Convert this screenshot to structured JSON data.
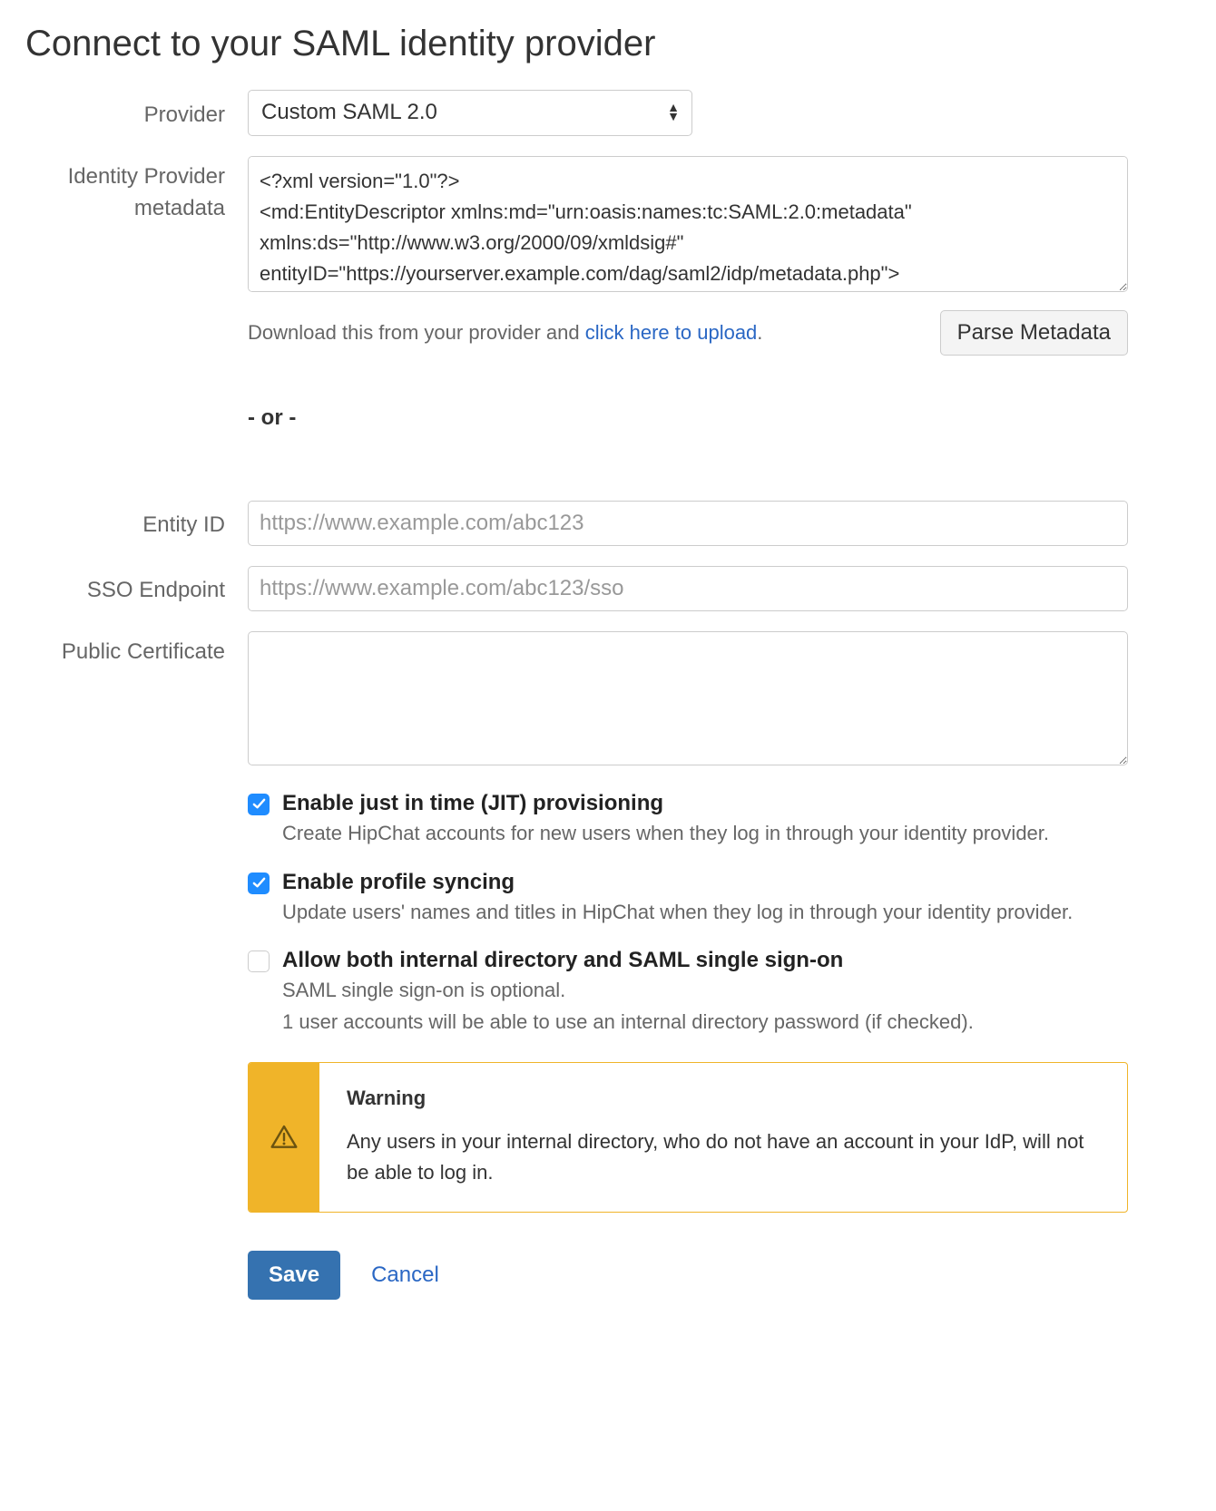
{
  "heading": "Connect to your SAML identity provider",
  "labels": {
    "provider": "Provider",
    "metadata": "Identity Provider metadata",
    "entity_id": "Entity ID",
    "sso_endpoint": "SSO Endpoint",
    "public_cert": "Public Certificate"
  },
  "provider": {
    "selected": "Custom SAML 2.0"
  },
  "metadata": {
    "value": "<?xml version=\"1.0\"?>\n<md:EntityDescriptor xmlns:md=\"urn:oasis:names:tc:SAML:2.0:metadata\" xmlns:ds=\"http://www.w3.org/2000/09/xmldsig#\" entityID=\"https://yourserver.example.com/dag/saml2/idp/metadata.php\">\n    <md:IDPSSODescriptor",
    "hint_prefix": "Download this from your provider and ",
    "hint_link": "click here to upload",
    "hint_suffix": ".",
    "parse_button": "Parse Metadata"
  },
  "or_separator": "- or -",
  "entity_id": {
    "placeholder": "https://www.example.com/abc123",
    "value": ""
  },
  "sso_endpoint": {
    "placeholder": "https://www.example.com/abc123/sso",
    "value": ""
  },
  "public_cert": {
    "value": ""
  },
  "checkboxes": {
    "jit": {
      "checked": true,
      "title": "Enable just in time (JIT) provisioning",
      "desc": "Create HipChat accounts for new users when they log in through your identity provider."
    },
    "sync": {
      "checked": true,
      "title": "Enable profile syncing",
      "desc": "Update users' names and titles in HipChat when they log in through your identity provider."
    },
    "allow_both": {
      "checked": false,
      "title": "Allow both internal directory and SAML single sign-on",
      "desc1": "SAML single sign-on is optional.",
      "desc2": "1 user accounts will be able to use an internal directory password (if checked)."
    }
  },
  "warning": {
    "title": "Warning",
    "text": "Any users in your internal directory, who do not have an account in your IdP, will not be able to log in."
  },
  "actions": {
    "save": "Save",
    "cancel": "Cancel"
  }
}
